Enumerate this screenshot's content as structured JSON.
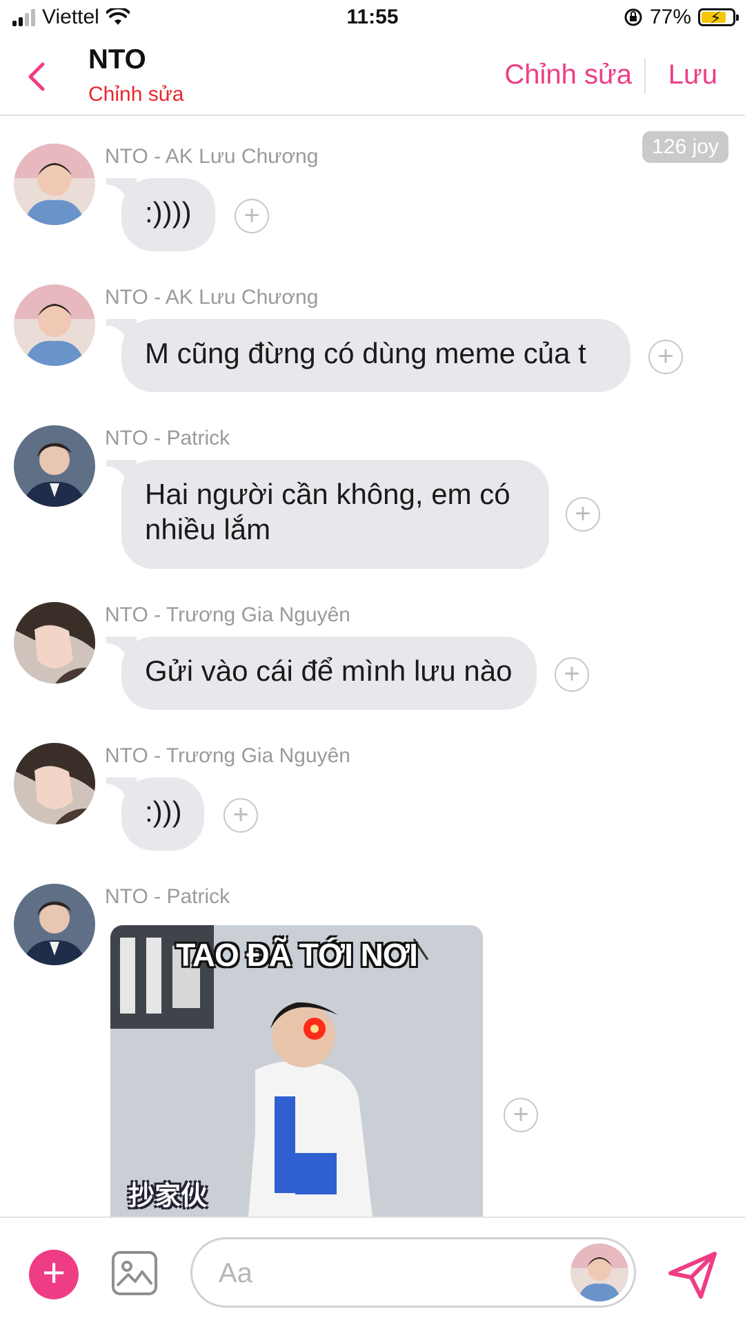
{
  "status_bar": {
    "carrier": "Viettel",
    "time": "11:55",
    "battery_percent": "77%",
    "icons": [
      "signal-icon",
      "wifi-icon",
      "orientation-lock-icon",
      "battery-charging-icon"
    ]
  },
  "header": {
    "back_icon": "chevron-left-icon",
    "title": "NTO",
    "subtitle": "Chỉnh sửa",
    "edit_label": "Chỉnh sửa",
    "save_label": "Lưu"
  },
  "joy_badge": "126 joy",
  "messages": [
    {
      "sender": "NTO - AK Lưu Chương",
      "text": ":))))"
    },
    {
      "sender": "NTO - AK Lưu Chương",
      "text": "M cũng đừng có dùng meme của t"
    },
    {
      "sender": "NTO - Patrick",
      "text": "Hai người cần không, em có nhiều lắm"
    },
    {
      "sender": "NTO - Trương Gia Nguyên",
      "text": "Gửi vào cái để mình lưu nào"
    },
    {
      "sender": "NTO - Trương Gia Nguyên",
      "text": ":)))"
    },
    {
      "sender": "NTO - Patrick",
      "image_top_caption": "TAO ĐÃ TỚI NƠI",
      "image_bottom_caption": "抄家伙"
    }
  ],
  "composer": {
    "placeholder": "Aa"
  },
  "colors": {
    "accent": "#ee3d85",
    "subtitle_red": "#e8262e",
    "bubble": "#e6e8eb",
    "muted_text": "#9a9a9a"
  }
}
